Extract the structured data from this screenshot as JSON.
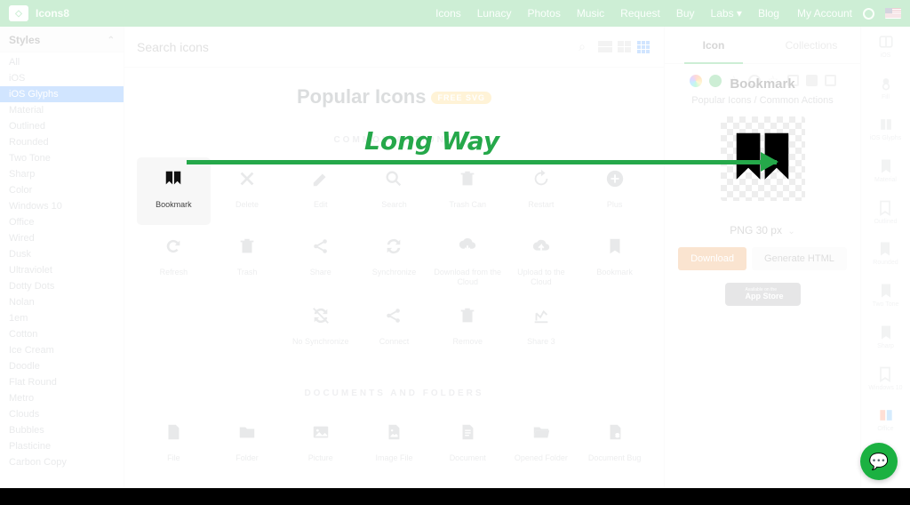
{
  "overlay_label": "Long Way",
  "nav": {
    "brand": "Icons8",
    "links": [
      "Icons",
      "Lunacy",
      "Photos",
      "Music",
      "Request",
      "Buy",
      "Labs ▾",
      "Blog"
    ],
    "account": "My Account"
  },
  "sidebar": {
    "title": "Styles",
    "items": [
      "All",
      "iOS",
      "iOS Glyphs",
      "Material",
      "Outlined",
      "Rounded",
      "Two Tone",
      "Sharp",
      "Color",
      "Windows 10",
      "Office",
      "Wired",
      "Dusk",
      "Ultraviolet",
      "Dotty Dots",
      "Nolan",
      "1em",
      "Cotton",
      "Ice Cream",
      "Doodle",
      "Flat Round",
      "Metro",
      "Clouds",
      "Bubbles",
      "Plasticine",
      "Carbon Copy"
    ],
    "selected": 2
  },
  "search": {
    "placeholder": "Search icons"
  },
  "page": {
    "title": "Popular Icons",
    "badge": "FREE SVG"
  },
  "sections": [
    {
      "label": "COMMON ACTIONS",
      "icons": [
        {
          "n": "Bookmark",
          "i": "bookmark",
          "sel": true
        },
        {
          "n": "Delete",
          "i": "x"
        },
        {
          "n": "Edit",
          "i": "pencil"
        },
        {
          "n": "Search",
          "i": "search"
        },
        {
          "n": "Trash Can",
          "i": "trash"
        },
        {
          "n": "Restart",
          "i": "restart"
        },
        {
          "n": "Plus",
          "i": "plus"
        },
        {
          "n": "Refresh",
          "i": "refresh"
        },
        {
          "n": "Trash",
          "i": "trash"
        },
        {
          "n": "Share",
          "i": "share"
        },
        {
          "n": "Synchronize",
          "i": "sync"
        },
        {
          "n": "Download from the Cloud",
          "i": "cloud-down"
        },
        {
          "n": "Upload to the Cloud",
          "i": "cloud-up"
        },
        {
          "n": "Bookmark",
          "i": "ribbon"
        },
        {
          "n": "No Synchronize",
          "i": "nosync"
        },
        {
          "n": "Connect",
          "i": "share"
        },
        {
          "n": "Remove",
          "i": "trash"
        },
        {
          "n": "Share 3",
          "i": "chart"
        }
      ],
      "pad": 2
    },
    {
      "label": "DOCUMENTS AND FOLDERS",
      "icons": [
        {
          "n": "File",
          "i": "file"
        },
        {
          "n": "Folder",
          "i": "folder"
        },
        {
          "n": "Picture",
          "i": "picture"
        },
        {
          "n": "Image File",
          "i": "imgfile"
        },
        {
          "n": "Document",
          "i": "doc"
        },
        {
          "n": "Opened Folder",
          "i": "openfolder"
        },
        {
          "n": "Document Bug",
          "i": "docbug"
        }
      ],
      "pad": 0
    }
  ],
  "detail": {
    "tabs": [
      "Icon",
      "Collections"
    ],
    "title": "Bookmark",
    "breadcrumb": "Popular Icons / Common Actions",
    "format": "PNG 30 px",
    "download": "Download",
    "generate": "Generate HTML",
    "appstore_t1": "Available on the",
    "appstore_t2": "App Store"
  },
  "rail": [
    {
      "n": "iOS",
      "i": "ios"
    },
    {
      "n": "Fill",
      "i": "fill"
    },
    {
      "n": "iOS Glyphs",
      "i": "glyph"
    },
    {
      "n": "Material",
      "i": "ribbon"
    },
    {
      "n": "Outlined",
      "i": "ribbon-o"
    },
    {
      "n": "Rounded",
      "i": "ribbon"
    },
    {
      "n": "Two Tone",
      "i": "ribbon"
    },
    {
      "n": "Sharp",
      "i": "ribbon"
    },
    {
      "n": "Windows 10",
      "i": "ribbon-o"
    },
    {
      "n": "Office",
      "i": "office"
    }
  ],
  "url_hint": "https://icons8.com/icon/59750/bookmark"
}
